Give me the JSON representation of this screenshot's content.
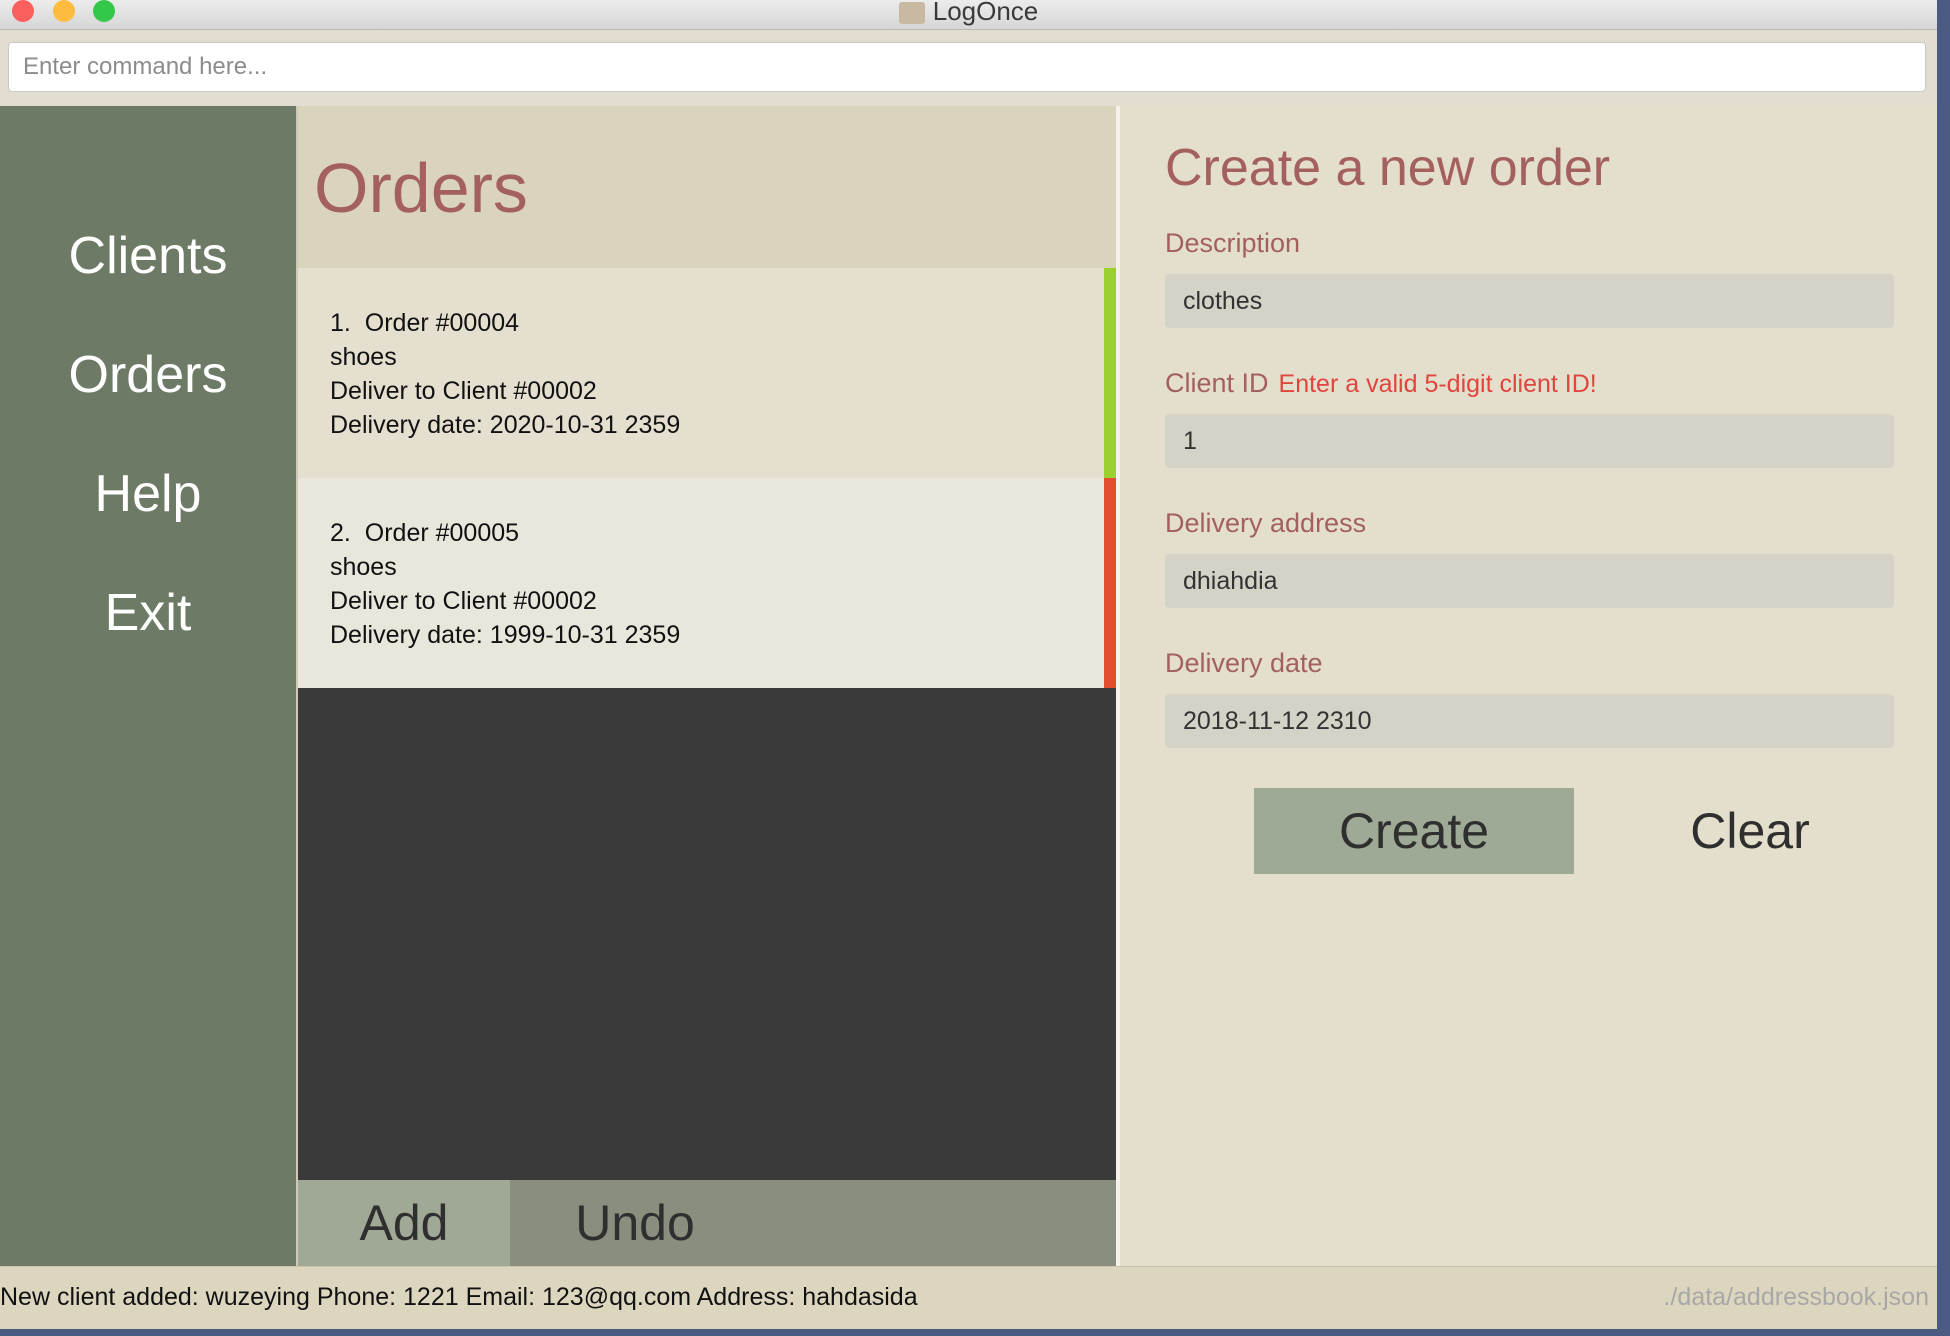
{
  "window": {
    "title": "LogOnce"
  },
  "command": {
    "placeholder": "Enter command here...",
    "value": ""
  },
  "sidebar": {
    "items": [
      {
        "label": "Clients"
      },
      {
        "label": "Orders"
      },
      {
        "label": "Help"
      },
      {
        "label": "Exit"
      }
    ]
  },
  "orders_panel": {
    "title": "Orders",
    "orders": [
      {
        "index": "1.",
        "order_id": "Order #00004",
        "description": "shoes",
        "client": "Deliver to Client #00002",
        "date": "Delivery date: 2020-10-31 2359",
        "status_color": "#9bd12e"
      },
      {
        "index": "2.",
        "order_id": "Order #00005",
        "description": "shoes",
        "client": "Deliver to Client #00002",
        "date": "Delivery date: 1999-10-31 2359",
        "status_color": "#e34e31"
      }
    ],
    "add_label": "Add",
    "undo_label": "Undo"
  },
  "form": {
    "title": "Create a new order",
    "description_label": "Description",
    "description_value": "clothes",
    "client_id_label": "Client ID",
    "client_id_error": "Enter a valid 5-digit client ID!",
    "client_id_value": "1",
    "address_label": "Delivery address",
    "address_value": "dhiahdia",
    "date_label": "Delivery date",
    "date_value": "2018-11-12 2310",
    "create_label": "Create",
    "clear_label": "Clear"
  },
  "status": {
    "message": "New client added: wuzeying Phone: 1221 Email: 123@qq.com Address: hahdasida",
    "path": "./data/addressbook.json"
  },
  "colors": {
    "sidebar": "#6d7a65",
    "accent_title": "#a3605f",
    "error": "#e0453e",
    "status_ok": "#9bd12e",
    "status_overdue": "#e34e31"
  }
}
